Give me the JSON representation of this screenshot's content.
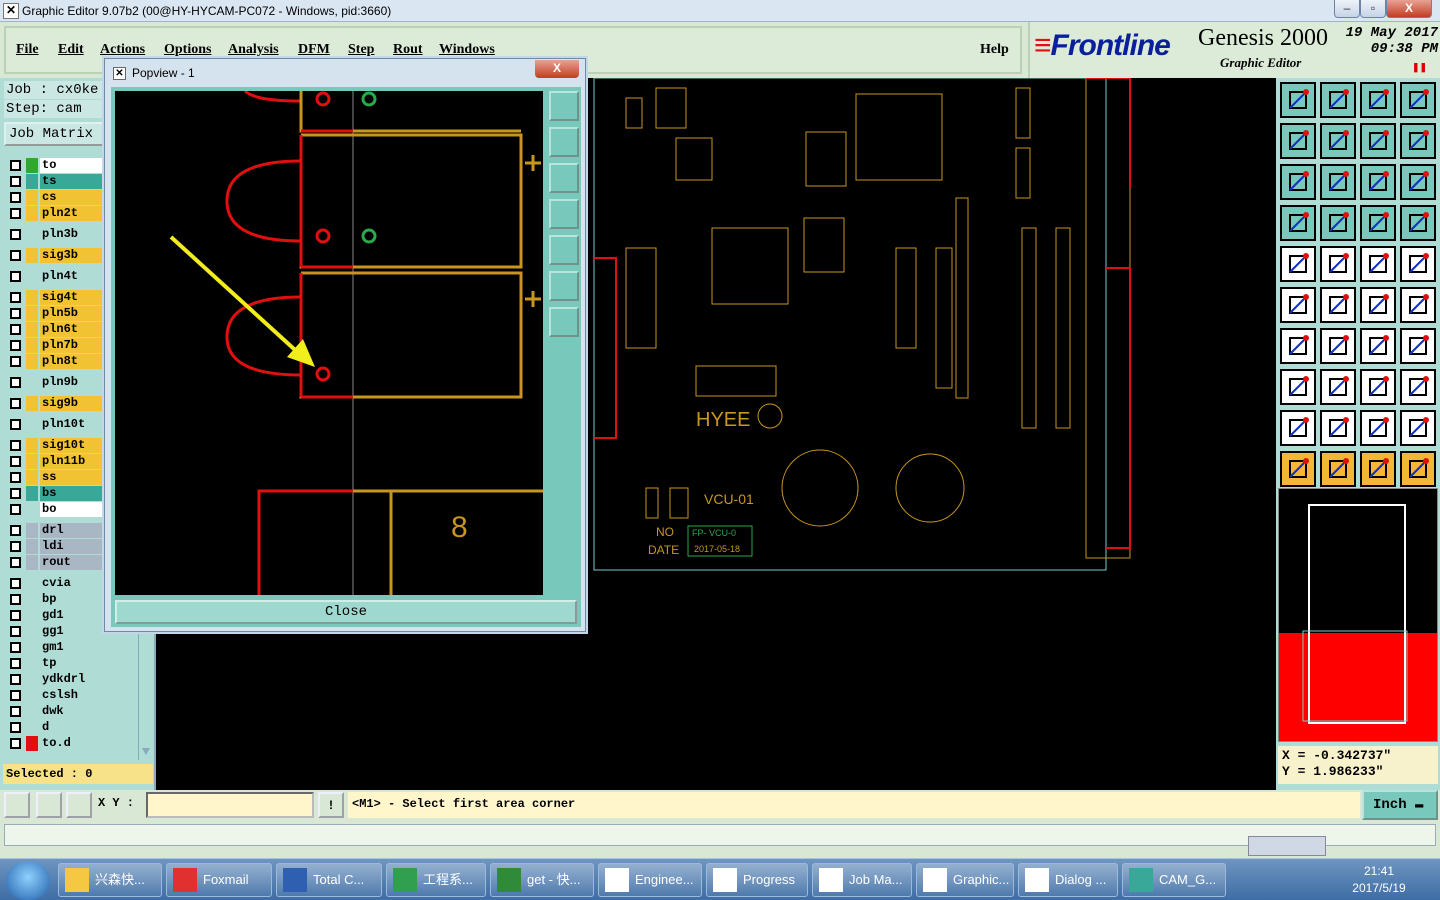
{
  "window": {
    "title": "Graphic Editor 9.07b2 (00@HY-HYCAM-PC072 - Windows, pid:3660)",
    "minimize": "–",
    "maximize": "▫",
    "close": "X"
  },
  "menu": {
    "items": [
      "File",
      "Edit",
      "Actions",
      "Options",
      "Analysis",
      "DFM",
      "Step",
      "Rout",
      "Windows"
    ],
    "help": "Help"
  },
  "logo": {
    "brand": "Frontline",
    "product": "Genesis 2000",
    "subtitle": "Graphic Editor",
    "date": "19 May 2017",
    "time": "09:38 PM"
  },
  "job": {
    "job_label": "Job : cx0ke",
    "step_label": "Step: cam",
    "matrix_button": "Job Matrix"
  },
  "layers": [
    {
      "name": "to",
      "color": "#ffffff",
      "swatch": "#2ea82e"
    },
    {
      "name": "ts",
      "color": "#3aa898",
      "swatch": "#3aa898"
    },
    {
      "name": "cs",
      "color": "#f1c232",
      "swatch": "#f1c232"
    },
    {
      "name": "pln2t",
      "color": "#f1c232",
      "swatch": "#f1c232"
    },
    {
      "name": "pln3b",
      "color": "#b0dcd6",
      "swatch": "#b0dcd6"
    },
    {
      "name": "sig3b",
      "color": "#f1c232",
      "swatch": "#f1c232"
    },
    {
      "name": "pln4t",
      "color": "#b0dcd6",
      "swatch": "#b0dcd6"
    },
    {
      "name": "sig4t",
      "color": "#f1c232",
      "swatch": "#f1c232"
    },
    {
      "name": "pln5b",
      "color": "#f1c232",
      "swatch": "#f1c232"
    },
    {
      "name": "pln6t",
      "color": "#f1c232",
      "swatch": "#f1c232"
    },
    {
      "name": "pln7b",
      "color": "#f1c232",
      "swatch": "#f1c232"
    },
    {
      "name": "pln8t",
      "color": "#f1c232",
      "swatch": "#f1c232"
    },
    {
      "name": "pln9b",
      "color": "#b0dcd6",
      "swatch": "#b0dcd6"
    },
    {
      "name": "sig9b",
      "color": "#f1c232",
      "swatch": "#f1c232"
    },
    {
      "name": "pln10t",
      "color": "#b0dcd6",
      "swatch": "#b0dcd6"
    },
    {
      "name": "sig10t",
      "color": "#f1c232",
      "swatch": "#f1c232"
    },
    {
      "name": "pln11b",
      "color": "#f1c232",
      "swatch": "#f1c232"
    },
    {
      "name": "ss",
      "color": "#f1c232",
      "swatch": "#f1c232"
    },
    {
      "name": "bs",
      "color": "#3aa898",
      "swatch": "#3aa898"
    },
    {
      "name": "bo",
      "color": "#ffffff",
      "swatch": "#b0dcd6"
    },
    {
      "name": "drl",
      "color": "#a9b6c4",
      "swatch": "#a9b6c4"
    },
    {
      "name": "ldi",
      "color": "#a9b6c4",
      "swatch": "#a9b6c4"
    },
    {
      "name": "rout",
      "color": "#a9b6c4",
      "swatch": "#a9b6c4"
    },
    {
      "name": "cvia",
      "color": "#b0dcd6",
      "swatch": "#b0dcd6"
    },
    {
      "name": "bp",
      "color": "#b0dcd6",
      "swatch": "#b0dcd6"
    },
    {
      "name": "gd1",
      "color": "#b0dcd6",
      "swatch": "#b0dcd6"
    },
    {
      "name": "gg1",
      "color": "#b0dcd6",
      "swatch": "#b0dcd6"
    },
    {
      "name": "gm1",
      "color": "#b0dcd6",
      "swatch": "#b0dcd6"
    },
    {
      "name": "tp",
      "color": "#b0dcd6",
      "swatch": "#b0dcd6"
    },
    {
      "name": "ydkdrl",
      "color": "#b0dcd6",
      "swatch": "#b0dcd6"
    },
    {
      "name": "cslsh",
      "color": "#b0dcd6",
      "swatch": "#b0dcd6"
    },
    {
      "name": "dwk",
      "color": "#b0dcd6",
      "swatch": "#b0dcd6"
    },
    {
      "name": "d",
      "color": "#b0dcd6",
      "swatch": "#b0dcd6"
    },
    {
      "name": "to.d",
      "color": "#b0dcd6",
      "swatch": "#e01010"
    }
  ],
  "selected_text": "Selected : 0",
  "popview": {
    "title": "Popview - 1",
    "close_label": "Close",
    "pad_number": "8"
  },
  "board": {
    "brand": "HYEE",
    "model": "VCU-01",
    "no_label": "NO",
    "date_label": "DATE",
    "fp_label": "FP-  VCU-0",
    "date_value": "2017-05-18"
  },
  "coords": {
    "x": "X = -0.342737\"",
    "y": "Y = 1.986233\""
  },
  "status": {
    "xy_label": "X Y :",
    "prompt": "<M1> - Select first area corner",
    "unit": "Inch",
    "bang": "!"
  },
  "taskbar": {
    "items": [
      "兴森快...",
      "Foxmail",
      "Total C...",
      "工程系...",
      "get - 快...",
      "Enginee...",
      "Progress",
      "Job Ma...",
      "Graphic...",
      "Dialog ...",
      "CAM_G..."
    ],
    "time": "21:41",
    "date": "2017/5/19"
  },
  "colors": {
    "accent_red": "#e01010",
    "trace_gold": "#c8961e",
    "cyan_panel": "#b0dcd6"
  }
}
